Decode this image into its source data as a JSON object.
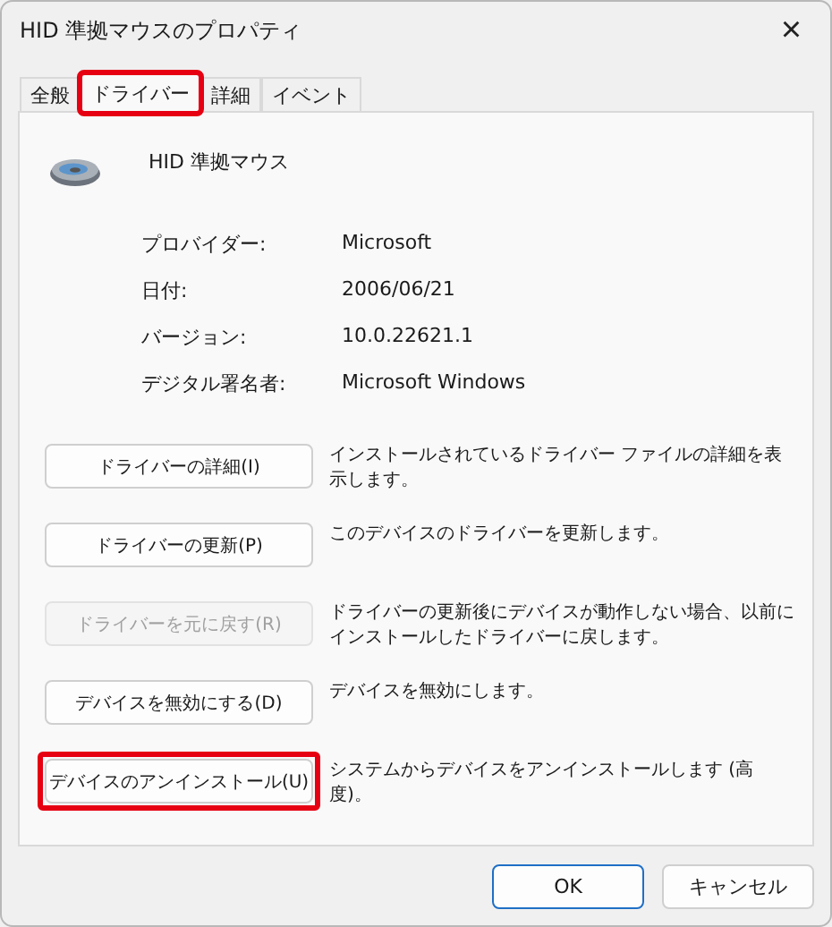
{
  "window": {
    "title": "HID 準拠マウスのプロパティ",
    "close": "×"
  },
  "tabs": [
    {
      "label": "全般",
      "selected": false,
      "highlighted": false
    },
    {
      "label": "ドライバー",
      "selected": true,
      "highlighted": true
    },
    {
      "label": "詳細",
      "selected": false,
      "highlighted": false
    },
    {
      "label": "イベント",
      "selected": false,
      "highlighted": false
    }
  ],
  "device": {
    "name": "HID 準拠マウス"
  },
  "properties": [
    {
      "label": "プロバイダー:",
      "value": "Microsoft"
    },
    {
      "label": "日付:",
      "value": "2006/06/21"
    },
    {
      "label": "バージョン:",
      "value": "10.0.22621.1"
    },
    {
      "label": "デジタル署名者:",
      "value": "Microsoft Windows"
    }
  ],
  "actions": [
    {
      "button": "ドライバーの詳細(I)",
      "description": "インストールされているドライバー ファイルの詳細を表示します。",
      "disabled": false,
      "highlighted": false
    },
    {
      "button": "ドライバーの更新(P)",
      "description": "このデバイスのドライバーを更新します。",
      "disabled": false,
      "highlighted": false
    },
    {
      "button": "ドライバーを元に戻す(R)",
      "description": "ドライバーの更新後にデバイスが動作しない場合、以前にインストールしたドライバーに戻します。",
      "disabled": true,
      "highlighted": false
    },
    {
      "button": "デバイスを無効にする(D)",
      "description": "デバイスを無効にします。",
      "disabled": false,
      "highlighted": false
    },
    {
      "button": "デバイスのアンインストール(U)",
      "description": "システムからデバイスをアンインストールします (高度)。",
      "disabled": false,
      "highlighted": true
    }
  ],
  "footer": {
    "buttons": [
      {
        "label": "OK",
        "kind": "default"
      },
      {
        "label": "キャンセル",
        "kind": "normal"
      }
    ]
  }
}
